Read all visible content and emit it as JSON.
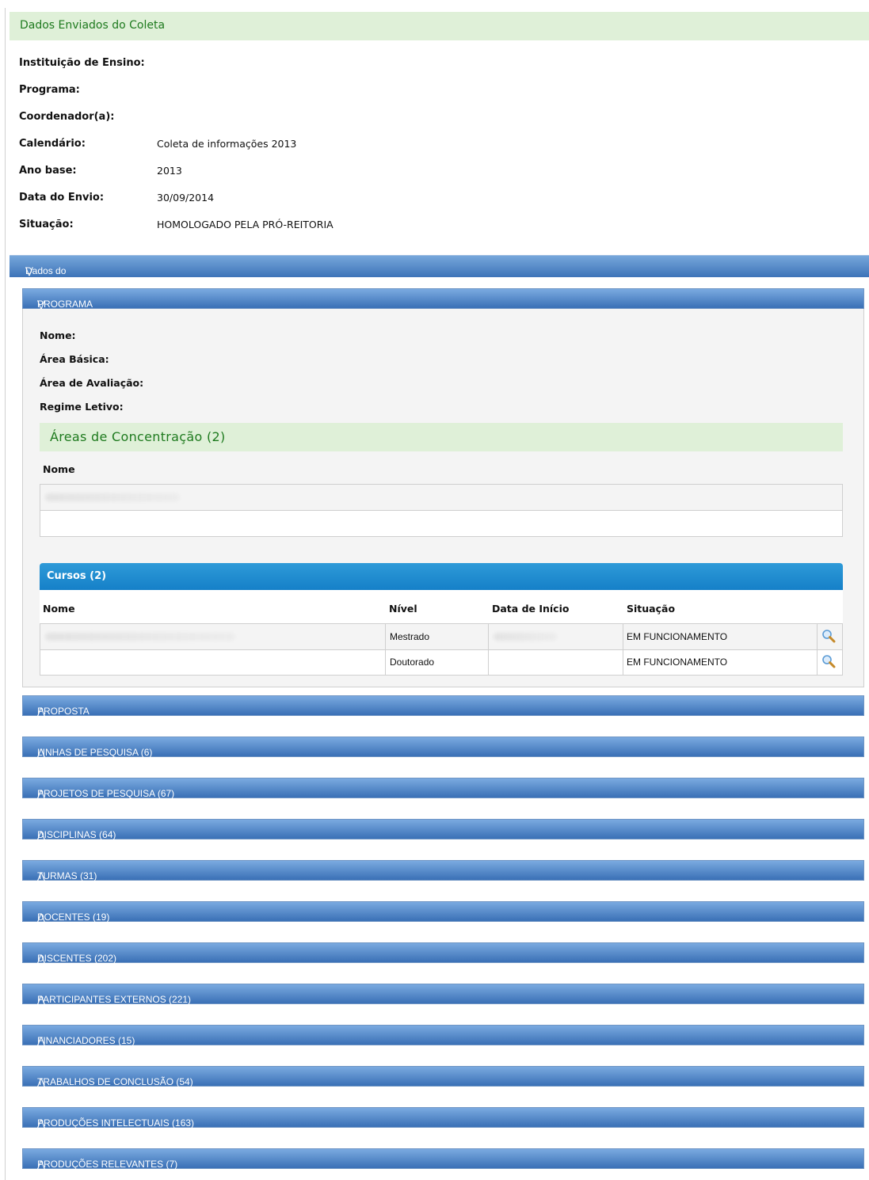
{
  "header": {
    "title": "Dados Enviados do Coleta"
  },
  "info": [
    {
      "label": "Instituição de Ensino:",
      "value": ""
    },
    {
      "label": "Programa:",
      "value": ""
    },
    {
      "label": "Coordenador(a):",
      "value": ""
    },
    {
      "label": "Calendário:",
      "value": "Coleta de informações 2013"
    },
    {
      "label": "Ano base:",
      "value": "2013"
    },
    {
      "label": "Data do Envio:",
      "value": "30/09/2014"
    },
    {
      "label": "Situação:",
      "value": "HOMOLOGADO PELA PRÓ-REITORIA"
    }
  ],
  "dados_programa": {
    "label": "Dados do Programa",
    "icon": "double-chevron-down-icon"
  },
  "programa": {
    "label": "PROGRAMA",
    "fields": [
      "Nome:",
      "Área Básica:",
      "Área de Avaliação:",
      "Regime Letivo:"
    ],
    "areas_title": "Áreas de Concentração (2)",
    "areas_header": "Nome",
    "cursos_title": "Cursos (2)",
    "cursos_headers": [
      "Nome",
      "Nível",
      "Data de Início",
      "Situação"
    ],
    "cursos_rows": [
      {
        "nome": "",
        "nivel": "Mestrado",
        "data": "",
        "situacao": "EM FUNCIONAMENTO"
      },
      {
        "nome": "",
        "nivel": "Doutorado",
        "data": "",
        "situacao": "EM FUNCIONAMENTO"
      }
    ]
  },
  "sections": [
    "PROPOSTA",
    "LINHAS DE PESQUISA (6)",
    "PROJETOS DE PESQUISA (67)",
    "DISCIPLINAS (64)",
    "TURMAS (31)",
    "DOCENTES (19)",
    "DISCENTES (202)",
    "PARTICIPANTES EXTERNOS (221)",
    "FINANCIADORES (15)",
    "TRABALHOS DE CONCLUSÃO (54)",
    "PRODUÇÕES INTELECTUAIS (163)",
    "PRODUÇÕES RELEVANTES (7)"
  ],
  "colors": {
    "header_green": "#dff0d8",
    "header_text": "#1e7a1e",
    "bar_blue": "#3d73b8",
    "cursos_blue": "#1580c8"
  }
}
